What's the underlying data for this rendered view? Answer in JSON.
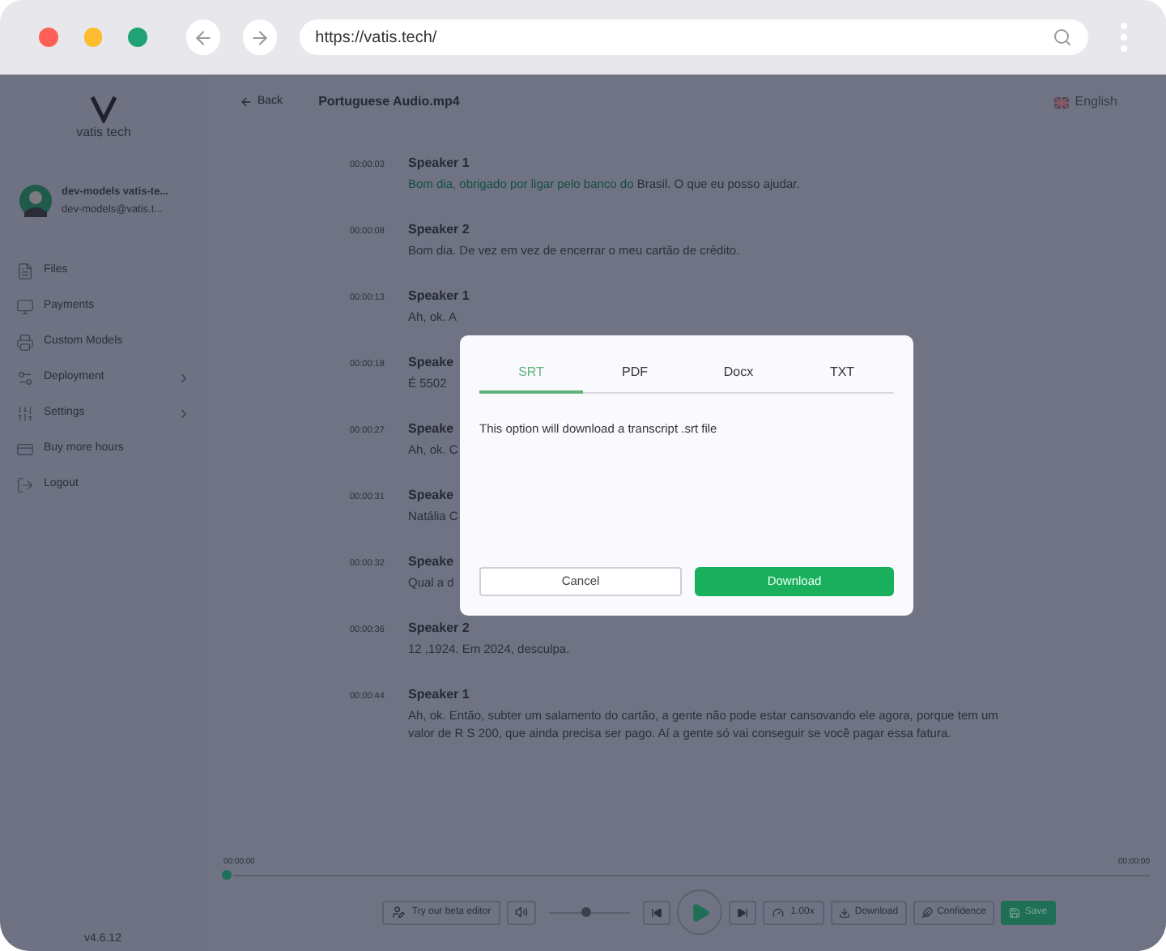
{
  "browser": {
    "url": "https://vatis.tech/"
  },
  "sidebar": {
    "logo_text": "vatis tech",
    "user": {
      "name": "dev-models vatis-te...",
      "email": "dev-models@vatis.t..."
    },
    "items": [
      {
        "label": "Files",
        "kind": "plain"
      },
      {
        "label": "Payments",
        "kind": "plain"
      },
      {
        "label": "Custom Models",
        "kind": "plain"
      },
      {
        "label": "Deployment",
        "kind": "expandable"
      },
      {
        "label": "Settings",
        "kind": "expandable"
      },
      {
        "label": "Buy more hours",
        "kind": "plain"
      },
      {
        "label": "Logout",
        "kind": "plain"
      }
    ],
    "version": "v4.6.12"
  },
  "header": {
    "back": "Back",
    "title": "Portuguese Audio.mp4",
    "language": "English"
  },
  "transcript": [
    {
      "time": "00:00:03",
      "speaker": "Speaker 1",
      "played": "Bom dia, obrigado por ligar pelo banco do",
      "text": "Brasil. O que eu posso ajudar."
    },
    {
      "time": "00:00:08",
      "speaker": "Speaker 2",
      "text": "Bom dia. De vez em vez de encerrar o meu cartão de crédito."
    },
    {
      "time": "00:00:13",
      "speaker": "Speaker 1",
      "text": "Ah, ok. A"
    },
    {
      "time": "00:00:18",
      "speaker": "Speake",
      "text": "É  5502"
    },
    {
      "time": "00:00:27",
      "speaker": "Speake",
      "text": "Ah, ok. C"
    },
    {
      "time": "00:00:31",
      "speaker": "Speake",
      "text": "Natália C"
    },
    {
      "time": "00:00:32",
      "speaker": "Speake",
      "text": "Qual a d"
    },
    {
      "time": "00:00:36",
      "speaker": "Speaker 2",
      "text": "12 ,1924. Em 2024, desculpa."
    },
    {
      "time": "00:00:44",
      "speaker": "Speaker 1",
      "text": "Ah, ok. Então, subter um salamento do cartão, a gente não pode estar cansovando ele agora, porque tem um valor de R S 200, que ainda precisa ser pago. Aí a gente só vai conseguir se você pagar essa fatura."
    }
  ],
  "player": {
    "current_time": "00:00:00",
    "end_time": "00:00:00",
    "progress": {
      "level": 0
    },
    "volume": {
      "level": 0.45
    },
    "beta": "Try our beta editor",
    "speed": "1.00x",
    "download": "Download",
    "confidence": "Confidence",
    "save": "Save"
  },
  "modal": {
    "tabs": [
      {
        "label": "SRT",
        "selected": true
      },
      {
        "label": "PDF",
        "selected": false
      },
      {
        "label": "Docx",
        "selected": false
      },
      {
        "label": "TXT",
        "selected": false
      }
    ],
    "message": "This option will download a transcript .srt file",
    "cancel": "Cancel",
    "download": "Download"
  }
}
